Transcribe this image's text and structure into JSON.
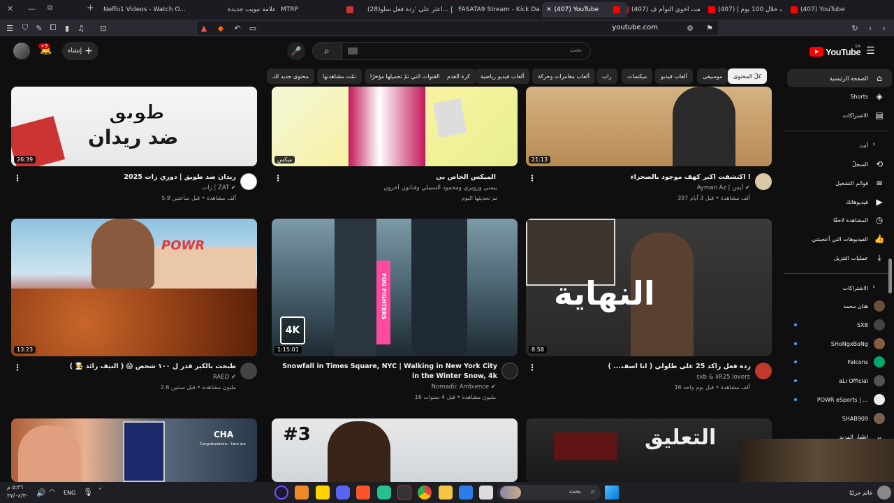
{
  "browser": {
    "tabs": [
      {
        "title": "(407) YouTube",
        "icon": "youtube"
      },
      {
        "title": "(407) انحف خلال 100 يوم إ...",
        "icon": "youtube"
      },
      {
        "title": "(407) خطفت اخوي التوأم ف...",
        "icon": "youtube"
      },
      {
        "title": "(407) YouTube",
        "icon": "youtube",
        "active": true
      },
      {
        "title": "FASATA9 Stream - Kick Da...",
        "icon": "kick"
      },
      {
        "title": "(28)اعثر على 'ردة فعل سلو...",
        "icon": "tiktok"
      },
      {
        "title": "MTRP",
        "icon": "generic"
      },
      {
        "title": "علامة تبويب جديدة",
        "icon": "none"
      },
      {
        "title": "Neffo1 Videos - Watch O...",
        "icon": "kick"
      }
    ],
    "url": "youtube.com"
  },
  "header": {
    "logo_text": "YouTube",
    "logo_region": "SA",
    "search_placeholder": "بحث",
    "create_label": "إنشاء",
    "notifications_badge": "+9"
  },
  "chips": [
    {
      "label": "كلّ المحتوى",
      "selected": true
    },
    {
      "label": "موسيقى"
    },
    {
      "label": "ألعاب فيديو"
    },
    {
      "label": "ميكسات"
    },
    {
      "label": "راب"
    },
    {
      "label": "ألعاب مغامرات وحركة"
    },
    {
      "label": "ألعاب فيديو رياضية"
    },
    {
      "label": "كرة القدم"
    },
    {
      "label": "القنوات التي تمّ تحميلها مؤخرًا"
    },
    {
      "label": "تمّت مشاهدتها"
    },
    {
      "label": "محتوى جديد لك"
    }
  ],
  "sidebar": {
    "main": [
      {
        "label": "الصفحة الرئيسية",
        "icon": "home-icon",
        "selected": true
      },
      {
        "label": "Shorts",
        "icon": "shorts-icon"
      },
      {
        "label": "الاشتراكات",
        "icon": "subscriptions-icon"
      }
    ],
    "you_heading": "أنت",
    "you": [
      {
        "label": "السجلّ",
        "icon": "history-icon"
      },
      {
        "label": "قوائم التشغيل",
        "icon": "playlists-icon"
      },
      {
        "label": "فيديوهاتك",
        "icon": "your-videos-icon"
      },
      {
        "label": "المشاهدة لاحقًا",
        "icon": "watch-later-icon"
      },
      {
        "label": "الفيديوهات التي أعجبتني",
        "icon": "liked-icon"
      },
      {
        "label": "عمليات التنزيل",
        "icon": "download-icon"
      }
    ],
    "subs_heading": "الاشتراكات",
    "subs": [
      {
        "label": "هتان محمد",
        "color": "#6b4e3d",
        "dot": false
      },
      {
        "label": "SXB",
        "color": "#444444",
        "dot": true
      },
      {
        "label": "SHoNgxBoNg",
        "color": "#8a5a44",
        "dot": true
      },
      {
        "label": "Falcons",
        "color": "#00a86b",
        "dot": true
      },
      {
        "label": "aLi Official",
        "color": "#555555",
        "dot": true
      },
      {
        "label": "POWR eSports | ...",
        "color": "#eeeeee",
        "dot": true
      },
      {
        "label": "SHAB909",
        "color": "#7a6050",
        "dot": false
      }
    ],
    "show_more": "إظهار المزيد"
  },
  "videos": [
    {
      "title": "اكتشفت اكبر كهف موجود بالصحراء !",
      "channel": "Ayman Az | أيمن",
      "meta": "397 ألف مشاهدة • قبل 3 أيام",
      "duration": "21:13",
      "verified": true
    },
    {
      "title": "الميكس الخاص بي",
      "channel": "بيسي وزويري ومحمود السبيلي وفنانون آخرون",
      "meta": "تم تحديثها اليوم",
      "duration": "ميكس",
      "verified": false
    },
    {
      "title": "ريدان ضد طويق | دوري زات 2025",
      "channel": "زات | ZAT",
      "meta": "5.8 ألف مشاهدة • قبل ساعتين",
      "duration": "26:39",
      "verified": true
    },
    {
      "title": "ردة فعل راكد 25 على طلولي ( انا اسف... )",
      "channel": "sxb & iiR25 lovers",
      "meta": "16 ألف مشاهدة • قبل يوم واحد",
      "duration": "8:58",
      "verified": false
    },
    {
      "title": "Snowfall in Times Square, NYC | Walking in New York City in the Winter Snow, 4k",
      "channel": "Nomadic Ambience",
      "meta": "16 مليون مشاهدة • قبل 4 سنوات",
      "duration": "1:15:01",
      "verified": true
    },
    {
      "title": "طبخت بالكير قدر ل ١٠٠ شخص 😱 ( التيف رائد 🧑‍🍳 )",
      "channel": "RAED",
      "meta": "2.6 مليون مشاهدة • قبل سنتين",
      "duration": "13:23",
      "verified": true
    }
  ],
  "thumb_texts": {
    "t1": "طويق",
    "t1b": "ضد ريدان",
    "t4": "النهاية",
    "t5_badge": "4K",
    "t5_sign": "FOO FIGHTERS",
    "t6": "POWR",
    "t8": "#3",
    "t9": "التعليق",
    "t7": "CHA",
    "t7b": "Congratulations - here are"
  },
  "taskbar": {
    "search_label": "بحث",
    "lang": "ENG",
    "time": "٥:٣٦ م",
    "date": "٢٧/٠٤/٣٠",
    "weather": "غائم جزئيًا"
  }
}
